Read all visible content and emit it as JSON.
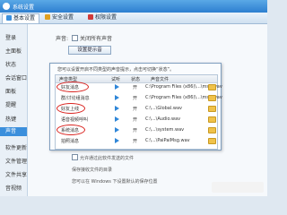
{
  "window": {
    "title": "系统设置"
  },
  "tabs": [
    {
      "label": "基本设置",
      "icon": "settings-icon",
      "color": "#3b8fdc"
    },
    {
      "label": "安全设置",
      "icon": "shield-icon",
      "color": "#e0a020"
    },
    {
      "label": "权限设置",
      "icon": "lock-icon",
      "color": "#d03a3a"
    }
  ],
  "sidebar": {
    "items": [
      {
        "label": "登录"
      },
      {
        "label": "主面板"
      },
      {
        "label": "状态"
      },
      {
        "label": "会话窗口"
      },
      {
        "label": "面板"
      },
      {
        "label": "提醒"
      },
      {
        "label": "热键"
      },
      {
        "label": "声音"
      },
      {
        "label": "软件更新"
      },
      {
        "label": "文件管理"
      },
      {
        "label": "文件共享"
      },
      {
        "label": "音视频"
      }
    ],
    "active_index": 7
  },
  "content": {
    "sound_label": "声音:",
    "mute_checkbox": "关闭所有声音",
    "tone_button": "设置提示音"
  },
  "dialog": {
    "hint": "您可以设置开启不同类型的声音提示，点击可切换“状态”。",
    "columns": [
      "声音类型",
      "试听",
      "状态",
      "声音文件"
    ],
    "rows": [
      {
        "type": "好友消息",
        "status": "开",
        "file": "C:\\Program Files (x86)\\...\\msg.wav"
      },
      {
        "type": "群/讨论组消息",
        "status": "开",
        "file": "C:\\Program Files (x86)\\...\\msg.wav"
      },
      {
        "type": "好友上线",
        "status": "开",
        "file": "C:\\...\\Global.wav"
      },
      {
        "type": "语音视频呼叫",
        "status": "开",
        "file": "C:\\...\\Audio.wav"
      },
      {
        "type": "系统消息",
        "status": "开",
        "file": "C:\\...\\system.wav"
      },
      {
        "type": "拍照消息",
        "status": "开",
        "file": "C:\\...\\PaiPaiMsg.wav"
      }
    ]
  },
  "footer": {
    "line1": "允许通过此软件发送的文件",
    "line2": "保存接收文件的目录",
    "line3": "您可以在 Windows 下设置默认的保存位置"
  },
  "colors": {
    "accent": "#3b8fdc",
    "highlight_circle": "#d9231f"
  }
}
